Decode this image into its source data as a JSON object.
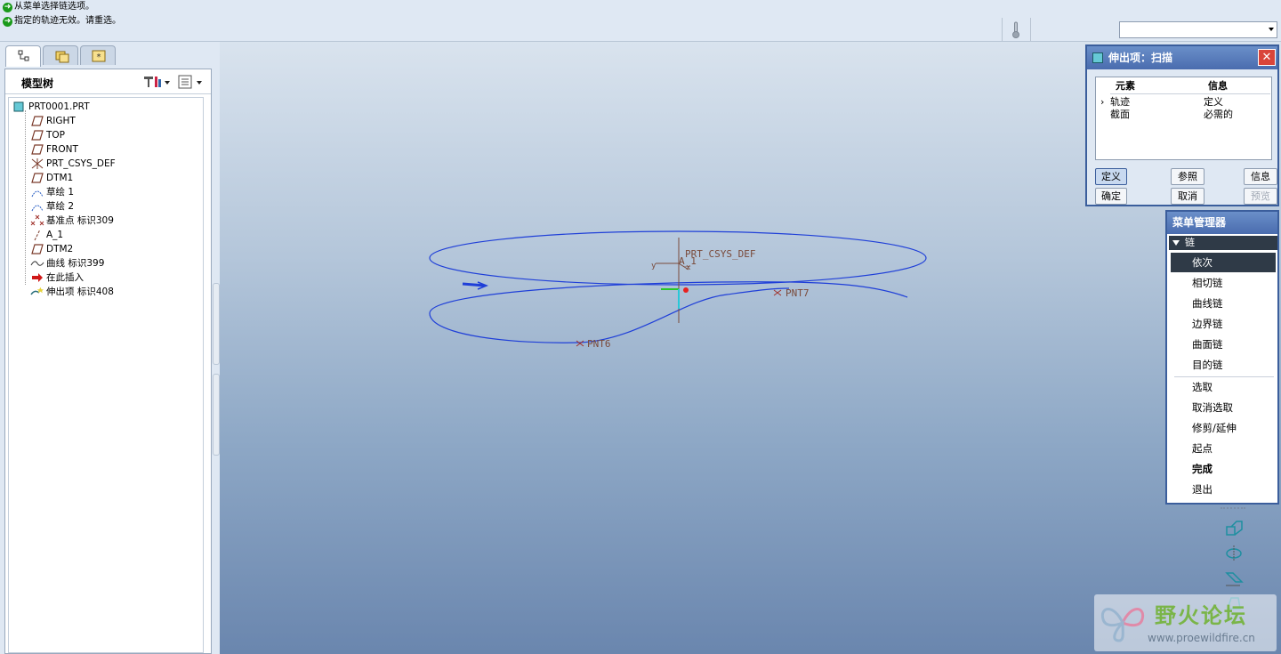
{
  "messages": [
    "从菜单选择链选项。",
    "指定的轨迹无效。请重选。"
  ],
  "model_tree": {
    "title": "模型树",
    "items": [
      {
        "label": "PRT0001.PRT",
        "icon": "part-icon"
      },
      {
        "label": "RIGHT",
        "icon": "datum-plane-icon"
      },
      {
        "label": "TOP",
        "icon": "datum-plane-icon"
      },
      {
        "label": "FRONT",
        "icon": "datum-plane-icon"
      },
      {
        "label": "PRT_CSYS_DEF",
        "icon": "csys-icon"
      },
      {
        "label": "DTM1",
        "icon": "datum-plane-icon"
      },
      {
        "label": "草绘 1",
        "icon": "sketch-icon"
      },
      {
        "label": "草绘 2",
        "icon": "sketch-icon"
      },
      {
        "label": "基准点 标识309",
        "icon": "datum-point-icon"
      },
      {
        "label": "A_1",
        "icon": "axis-icon"
      },
      {
        "label": "DTM2",
        "icon": "datum-plane-icon"
      },
      {
        "label": "曲线 标识399",
        "icon": "curve-icon"
      },
      {
        "label": "在此插入",
        "icon": "insert-arrow-icon"
      },
      {
        "label": "伸出项 标识408",
        "icon": "protrusion-icon"
      }
    ]
  },
  "viewport": {
    "labels": {
      "csys": "PRT_CSYS_DEF",
      "axis": "A_1",
      "pnt7": "PNT7",
      "pnt6": "PNT6",
      "x": "x",
      "y": "y"
    }
  },
  "dialog": {
    "title": "伸出项：扫描",
    "col_element": "元素",
    "col_info": "信息",
    "rows": [
      {
        "element": "轨迹",
        "info": "定义",
        "current": true
      },
      {
        "element": "截面",
        "info": "必需的",
        "current": false
      }
    ],
    "buttons": {
      "define": "定义",
      "refs": "参照",
      "info": "信息",
      "ok": "确定",
      "cancel": "取消",
      "preview": "预览"
    }
  },
  "menu_manager": {
    "title": "菜单管理器",
    "submenu": "链",
    "items_group1": [
      "依次",
      "相切链",
      "曲线链",
      "边界链",
      "曲面链",
      "目的链"
    ],
    "items_group2": [
      "选取",
      "取消选取",
      "修剪/延伸",
      "起点",
      "完成",
      "退出"
    ],
    "highlighted": "依次"
  },
  "watermark": {
    "text": "野火论坛",
    "url": "www.proewildfire.cn"
  },
  "colors": {
    "curve": "#1f3fd8",
    "dialog_border": "#3b5e9c",
    "menu_highlight": "#2f3a47",
    "watermark_green": "#7ab548"
  }
}
